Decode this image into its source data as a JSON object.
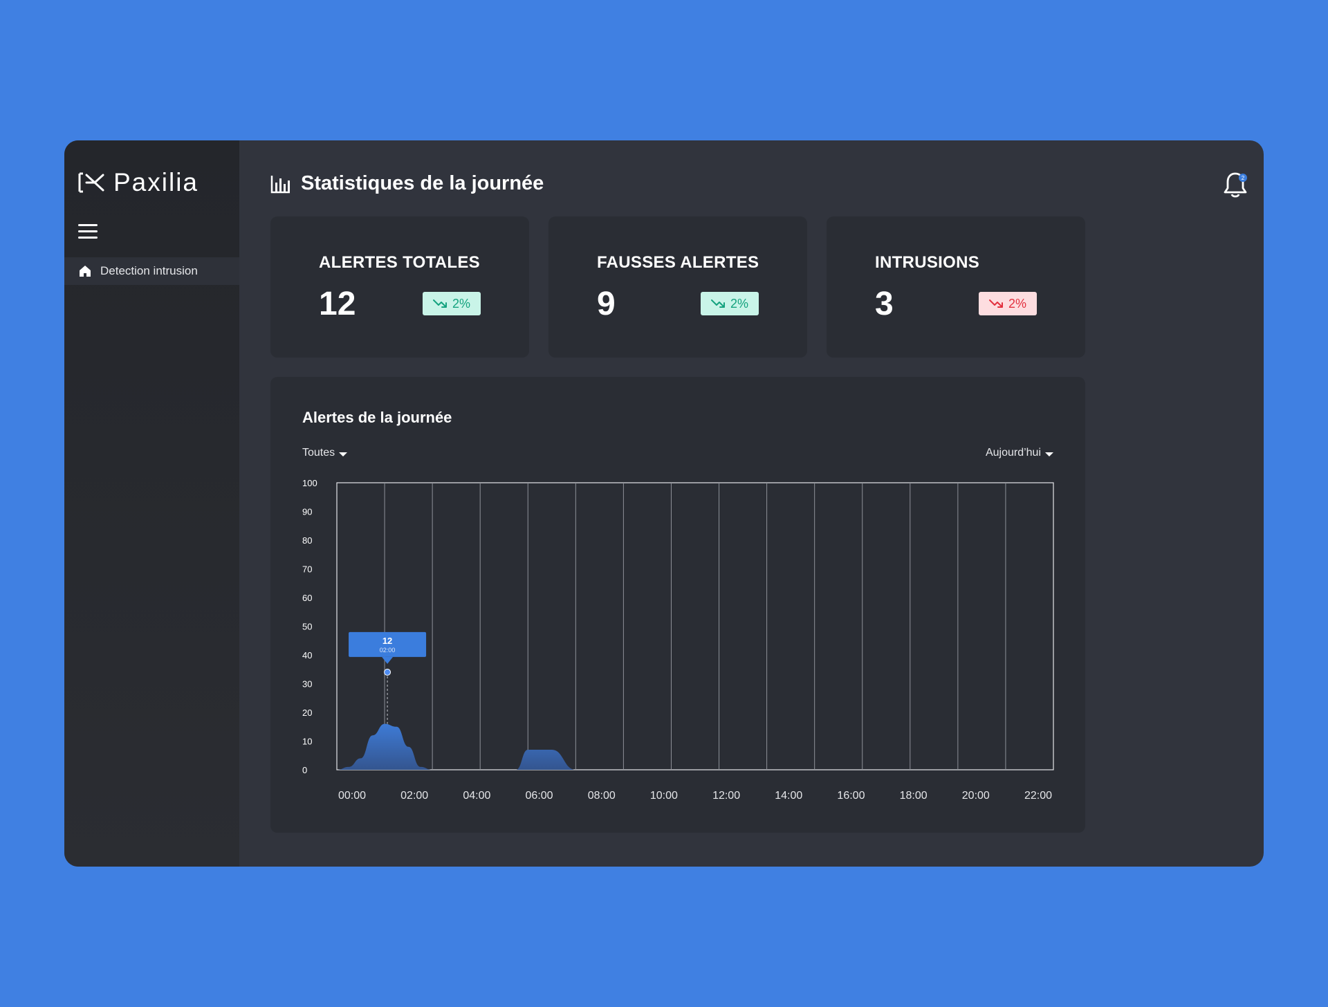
{
  "app": {
    "brand": "Paxilia"
  },
  "sidebar": {
    "items": [
      {
        "label": "Detection intrusion",
        "icon": "home-icon",
        "active": true
      }
    ]
  },
  "header": {
    "title": "Statistiques de la journée",
    "notification_count": "2"
  },
  "stats": [
    {
      "title": "ALERTES TOTALES",
      "value": "12",
      "change": "2%",
      "trend": "down",
      "status": "good"
    },
    {
      "title": "FAUSSES ALERTES",
      "value": "9",
      "change": "2%",
      "trend": "down",
      "status": "good"
    },
    {
      "title": "INTRUSIONS",
      "value": "3",
      "change": "2%",
      "trend": "down",
      "status": "bad"
    }
  ],
  "chart": {
    "title": "Alertes de la journée",
    "filter_type": "Toutes",
    "filter_period": "Aujourd’hui"
  },
  "colors": {
    "background": "#4080E2",
    "app": "#31343D",
    "card": "#2A2D34",
    "accent": "#3B7DDD",
    "good": "#14A27E",
    "bad": "#E2303E"
  },
  "chart_data": {
    "type": "area",
    "title": "",
    "xlabel": "",
    "ylabel": "",
    "ylim": [
      0,
      100
    ],
    "yticks": [
      0,
      10,
      20,
      30,
      40,
      50,
      60,
      70,
      80,
      90,
      100
    ],
    "x_tick_labels": [
      "00:00",
      "02:00",
      "04:00",
      "06:00",
      "08:00",
      "10:00",
      "12:00",
      "14:00",
      "16:00",
      "18:00",
      "20:00",
      "22:00"
    ],
    "grid": true,
    "x": [
      0,
      0.5,
      1,
      1.5,
      2,
      2.5,
      3,
      3.5,
      4,
      5,
      5.5,
      6,
      6.5,
      7,
      7.5,
      8,
      9,
      10,
      11,
      12,
      13,
      14,
      15,
      16,
      17,
      18,
      19,
      20,
      21,
      22
    ],
    "values": [
      0,
      1,
      4,
      12,
      16,
      15,
      8,
      1,
      0,
      0,
      0,
      0,
      0,
      0,
      0,
      7,
      7,
      0,
      0,
      0,
      0,
      0,
      0,
      0,
      0,
      0,
      0,
      0,
      0,
      0
    ],
    "tooltip": {
      "value": "12",
      "time": "02:00"
    }
  }
}
